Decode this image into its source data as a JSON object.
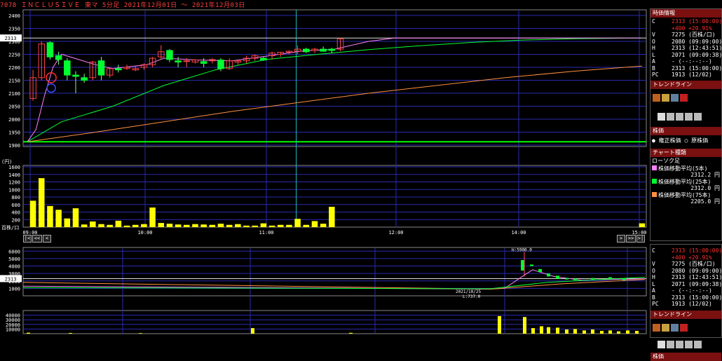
{
  "header": {
    "title": "7078 ＩＮＣＬＵＳＩＶＥ 東マ 5分足 2021年12月01日 ～ 2021年12月03日"
  },
  "price_axis": {
    "ticks": [
      "2400",
      "2350",
      "2300",
      "2250",
      "2200",
      "2150",
      "2100",
      "2050",
      "2000",
      "1950",
      "1900"
    ],
    "current_marker": "2313"
  },
  "volume_axis": {
    "unit_label": "(円)",
    "ticks": [
      "1600",
      "1400",
      "1200",
      "1000",
      "800",
      "600",
      "400",
      "200"
    ],
    "bottom_label": "百株/口"
  },
  "time_axis": {
    "ticks": [
      "09:00",
      "10:00",
      "11:00",
      "12:00",
      "14:00",
      "15:00"
    ]
  },
  "nav_buttons": {
    "first": "|<",
    "prev_fast": "<<",
    "prev": "<",
    "next": ">",
    "next_fast": ">>",
    "last": ">|"
  },
  "lower_chart": {
    "price_ticks": [
      "6000",
      "5000",
      "4000",
      "3000",
      "2000",
      "1000"
    ],
    "current_marker": "2313",
    "vol_ticks": [
      "40000",
      "30000",
      "20000",
      "10000"
    ],
    "high_annotation": "H:5900.0",
    "low_annotation_date": "2021/10/25",
    "low_annotation": "L:737.0"
  },
  "side_panel": {
    "info_title": "時価情報",
    "rows": [
      {
        "k": "C",
        "v": "2313 (15:00:00)",
        "red": true
      },
      {
        "k": "",
        "v": "+400 +20.91%",
        "red": true
      },
      {
        "k": "V",
        "v": "7275 (百株/口)",
        "red": false
      },
      {
        "k": "O",
        "v": "2080 (09:09:00)",
        "red": false
      },
      {
        "k": "H",
        "v": "2313 (12:43:51)",
        "red": false
      },
      {
        "k": "L",
        "v": "2071 (09:09:38)",
        "red": false
      },
      {
        "k": "A",
        "v": "- (--:--:--)",
        "red": false
      },
      {
        "k": "B",
        "v": "2313 (15:00:00)",
        "red": false
      },
      {
        "k": "PC",
        "v": "1913 (12/02)",
        "red": false
      }
    ],
    "trendline_title": "トレンドライン",
    "kabuka_title": "株価",
    "kabuka_opt1": "権正株価",
    "kabuka_opt2": "原株価",
    "chart_kind_title": "チャート種類",
    "chart_kind_value": "ローソク足",
    "ma": [
      {
        "label": "株価移動平均(5本)",
        "value": "2312.2 円",
        "color": "#ff80ff"
      },
      {
        "label": "株価移動平均(25本)",
        "value": "2312.0 円",
        "color": "#00ff30"
      },
      {
        "label": "株価移動平均(75本)",
        "value": "2205.0 円",
        "color": "#ff9040"
      }
    ],
    "lower_rows": [
      {
        "k": "C",
        "v": "2313 (15:00:00)",
        "red": true
      },
      {
        "k": "",
        "v": "+400 +20.91%",
        "red": true
      },
      {
        "k": "V",
        "v": "7275 (百株/口)",
        "red": false
      },
      {
        "k": "O",
        "v": "2080 (09:09:00)",
        "red": false
      },
      {
        "k": "H",
        "v": "2313 (12:43:51)",
        "red": false
      },
      {
        "k": "L",
        "v": "2071 (09:09:38)",
        "red": false
      },
      {
        "k": "A",
        "v": "- (--:--:--)",
        "red": false
      },
      {
        "k": "B",
        "v": "2313 (15:00:00)",
        "red": false
      },
      {
        "k": "PC",
        "v": "1913 (12/02)",
        "red": false
      }
    ],
    "lower_trendline_title": "トレンドライン",
    "lower_kabuka_title": "株価"
  },
  "chart_data": {
    "type": "candlestick",
    "x": [
      "09:00",
      "09:05",
      "09:10",
      "09:15",
      "09:20",
      "09:25",
      "09:30",
      "09:35",
      "09:40",
      "09:45",
      "09:50",
      "09:55",
      "10:00",
      "10:05",
      "10:10",
      "10:15",
      "10:20",
      "10:25",
      "10:30",
      "10:35",
      "10:40",
      "10:45",
      "10:50",
      "10:55",
      "11:00",
      "11:05",
      "11:10",
      "11:15",
      "11:20",
      "11:25",
      "11:30",
      "11:35",
      "11:40",
      "11:45",
      "11:50",
      "11:55",
      "12:00",
      "12:05",
      "12:10",
      "12:15",
      "12:20",
      "12:25",
      "12:30",
      "12:35",
      "12:40",
      "12:45",
      "12:50",
      "12:55",
      "13:00",
      "13:05",
      "13:10",
      "13:15",
      "13:20",
      "13:25",
      "13:30",
      "13:35",
      "13:40",
      "13:45",
      "13:50",
      "13:55",
      "14:00",
      "14:05",
      "14:10",
      "14:15",
      "14:20",
      "14:25",
      "14:30",
      "14:35",
      "14:40",
      "14:45",
      "14:50",
      "14:55",
      "15:00"
    ],
    "ohlc": [
      {
        "i": 1,
        "o": 2080,
        "h": 2190,
        "l": 2071,
        "c": 2160
      },
      {
        "i": 2,
        "o": 2160,
        "h": 2300,
        "l": 2150,
        "c": 2290
      },
      {
        "i": 3,
        "o": 2295,
        "h": 2300,
        "l": 2230,
        "c": 2240
      },
      {
        "i": 4,
        "o": 2245,
        "h": 2260,
        "l": 2210,
        "c": 2230
      },
      {
        "i": 5,
        "o": 2225,
        "h": 2235,
        "l": 2150,
        "c": 2170
      },
      {
        "i": 6,
        "o": 2170,
        "h": 2185,
        "l": 2100,
        "c": 2165
      },
      {
        "i": 7,
        "o": 2160,
        "h": 2175,
        "l": 2140,
        "c": 2150
      },
      {
        "i": 8,
        "o": 2160,
        "h": 2225,
        "l": 2150,
        "c": 2220
      },
      {
        "i": 9,
        "o": 2225,
        "h": 2240,
        "l": 2150,
        "c": 2170
      },
      {
        "i": 10,
        "o": 2170,
        "h": 2200,
        "l": 2160,
        "c": 2195
      },
      {
        "i": 11,
        "o": 2195,
        "h": 2210,
        "l": 2180,
        "c": 2190
      },
      {
        "i": 12,
        "o": 2195,
        "h": 2210,
        "l": 2190,
        "c": 2200
      },
      {
        "i": 13,
        "o": 2190,
        "h": 2205,
        "l": 2185,
        "c": 2195
      },
      {
        "i": 14,
        "o": 2200,
        "h": 2215,
        "l": 2190,
        "c": 2210
      },
      {
        "i": 15,
        "o": 2210,
        "h": 2240,
        "l": 2200,
        "c": 2235
      },
      {
        "i": 16,
        "o": 2240,
        "h": 2285,
        "l": 2230,
        "c": 2260
      },
      {
        "i": 17,
        "o": 2265,
        "h": 2270,
        "l": 2220,
        "c": 2230
      },
      {
        "i": 18,
        "o": 2225,
        "h": 2240,
        "l": 2200,
        "c": 2220
      },
      {
        "i": 19,
        "o": 2225,
        "h": 2235,
        "l": 2200,
        "c": 2225
      },
      {
        "i": 20,
        "o": 2220,
        "h": 2230,
        "l": 2215,
        "c": 2228
      },
      {
        "i": 21,
        "o": 2222,
        "h": 2235,
        "l": 2200,
        "c": 2215
      },
      {
        "i": 22,
        "o": 2225,
        "h": 2235,
        "l": 2215,
        "c": 2230
      },
      {
        "i": 23,
        "o": 2228,
        "h": 2235,
        "l": 2185,
        "c": 2195
      },
      {
        "i": 24,
        "o": 2195,
        "h": 2235,
        "l": 2190,
        "c": 2225
      },
      {
        "i": 25,
        "o": 2220,
        "h": 2230,
        "l": 2210,
        "c": 2225
      },
      {
        "i": 26,
        "o": 2225,
        "h": 2245,
        "l": 2215,
        "c": 2235
      },
      {
        "i": 27,
        "o": 2235,
        "h": 2250,
        "l": 2225,
        "c": 2245
      },
      {
        "i": 28,
        "o": 2235,
        "h": 2240,
        "l": 2225,
        "c": 2228
      },
      {
        "i": 29,
        "o": 2245,
        "h": 2260,
        "l": 2230,
        "c": 2255
      },
      {
        "i": 30,
        "o": 2250,
        "h": 2260,
        "l": 2240,
        "c": 2258
      },
      {
        "i": 31,
        "o": 2258,
        "h": 2265,
        "l": 2250,
        "c": 2262
      },
      {
        "i": 32,
        "o": 2262,
        "h": 2285,
        "l": 2250,
        "c": 2270
      },
      {
        "i": 33,
        "o": 2270,
        "h": 2275,
        "l": 2255,
        "c": 2260
      },
      {
        "i": 34,
        "o": 2265,
        "h": 2275,
        "l": 2255,
        "c": 2270
      },
      {
        "i": 35,
        "o": 2270,
        "h": 2280,
        "l": 2260,
        "c": 2262
      },
      {
        "i": 36,
        "o": 2270,
        "h": 2275,
        "l": 2255,
        "c": 2265
      },
      {
        "i": 37,
        "o": 2270,
        "h": 2313,
        "l": 2262,
        "c": 2310
      }
    ],
    "ma5": [
      [
        0,
        1913
      ],
      [
        1,
        1960
      ],
      [
        2,
        2090
      ],
      [
        3,
        2200
      ],
      [
        4,
        2250
      ],
      [
        6,
        2230
      ],
      [
        8,
        2210
      ],
      [
        10,
        2195
      ],
      [
        14,
        2210
      ],
      [
        16,
        2235
      ],
      [
        20,
        2228
      ],
      [
        24,
        2225
      ],
      [
        28,
        2243
      ],
      [
        32,
        2262
      ],
      [
        36,
        2270
      ],
      [
        40,
        2300
      ],
      [
        43,
        2313
      ],
      [
        72,
        2313
      ]
    ],
    "ma25": [
      [
        0,
        1913
      ],
      [
        4,
        1990
      ],
      [
        10,
        2050
      ],
      [
        16,
        2130
      ],
      [
        22,
        2190
      ],
      [
        28,
        2230
      ],
      [
        34,
        2250
      ],
      [
        40,
        2268
      ],
      [
        46,
        2283
      ],
      [
        52,
        2296
      ],
      [
        58,
        2305
      ],
      [
        64,
        2310
      ],
      [
        72,
        2313
      ]
    ],
    "ma75": [
      [
        0,
        1913
      ],
      [
        8,
        1950
      ],
      [
        16,
        1990
      ],
      [
        24,
        2030
      ],
      [
        32,
        2065
      ],
      [
        40,
        2100
      ],
      [
        48,
        2130
      ],
      [
        56,
        2160
      ],
      [
        64,
        2185
      ],
      [
        72,
        2205
      ]
    ],
    "volume": [
      700,
      1300,
      560,
      460,
      230,
      500,
      70,
      150,
      80,
      60,
      170,
      40,
      60,
      80,
      520,
      110,
      90,
      70,
      60,
      80,
      70,
      60,
      90,
      60,
      80,
      40,
      40,
      100,
      40,
      60,
      60,
      220,
      60,
      160,
      90,
      540
    ],
    "volume_last": 100,
    "ylim": [
      1900,
      2400
    ],
    "vol_ylim": [
      0,
      1600
    ],
    "ref_lines": {
      "previous_close": 1913,
      "current": 2313
    },
    "vertical_marker_time": "11:35"
  },
  "colors": {
    "up": "#00ff30",
    "down": "#ff3030",
    "volume": "#ffff00",
    "grid": "#2a2ab0",
    "ma5": "#ff80ff",
    "ma25": "#00ff30",
    "ma75": "#ff9040",
    "pc_line": "#00ff00"
  }
}
